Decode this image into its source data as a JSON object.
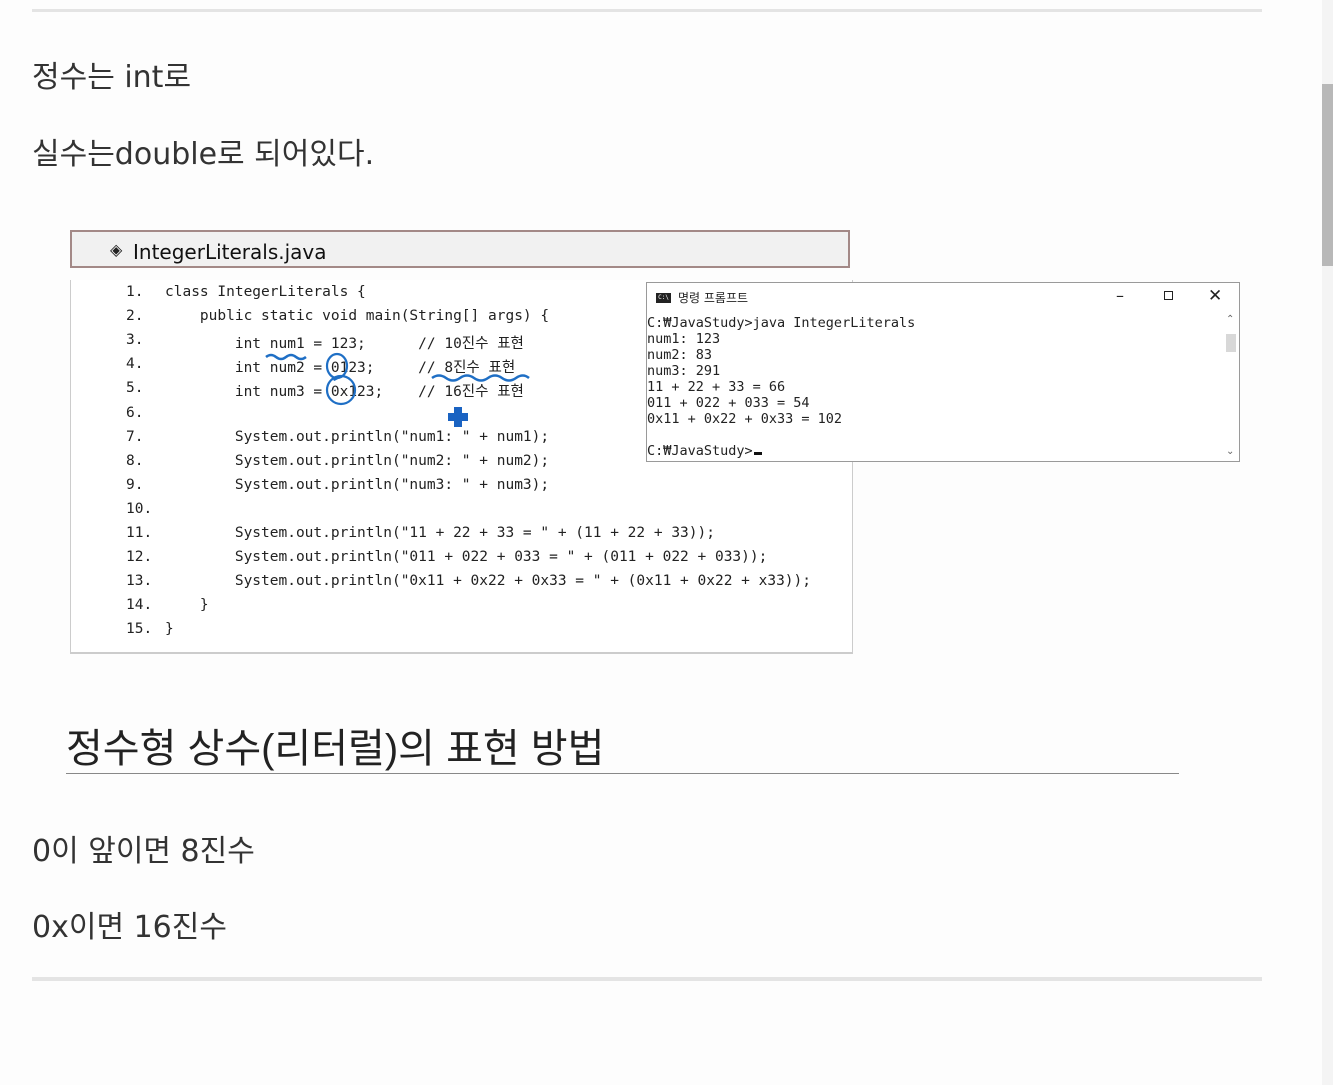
{
  "paragraphs": {
    "p1": "정수는 int로",
    "p2": "실수는double로 되어있다.",
    "p3": "0이 앞이면 8진수",
    "p4": "0x이면 16진수"
  },
  "figure": {
    "file_marker": "◈",
    "file_name": "IntegerLiterals.java",
    "code_lines": [
      {
        "num": "1.",
        "text": "class IntegerLiterals {"
      },
      {
        "num": "2.",
        "text": "    public static void main(String[] args) {"
      },
      {
        "num": "3.",
        "text": "        int num1 = 123;      // 10진수 표현"
      },
      {
        "num": "4.",
        "text": "        int num2 = 0123;     // 8진수 표현"
      },
      {
        "num": "5.",
        "text": "        int num3 = 0x123;    // 16진수 표현"
      },
      {
        "num": "6.",
        "text": ""
      },
      {
        "num": "7.",
        "text": "        System.out.println(\"num1: \" + num1);"
      },
      {
        "num": "8.",
        "text": "        System.out.println(\"num2: \" + num2);"
      },
      {
        "num": "9.",
        "text": "        System.out.println(\"num3: \" + num3);"
      },
      {
        "num": "10.",
        "text": ""
      },
      {
        "num": "11.",
        "text": "        System.out.println(\"11 + 22 + 33 = \" + (11 + 22 + 33));"
      },
      {
        "num": "12.",
        "text": "        System.out.println(\"011 + 022 + 033 = \" + (011 + 022 + 033));"
      },
      {
        "num": "13.",
        "text": "        System.out.println(\"0x11 + 0x22 + 0x33 = \" + (0x11 + 0x22 + x33));"
      },
      {
        "num": "14.",
        "text": "    }"
      },
      {
        "num": "15.",
        "text": "}"
      }
    ],
    "annotation_color": "#1f6fc5"
  },
  "console": {
    "icon_text": "C:\\",
    "title": "명령 프롬프트",
    "minimize": "–",
    "close": "✕",
    "lines": [
      "C:₩JavaStudy>java IntegerLiterals",
      "num1: 123",
      "num2: 83",
      "num3: 291",
      "11 + 22 + 33 = 66",
      "011 + 022 + 033 = 54",
      "0x11 + 0x22 + 0x33 = 102",
      "",
      "C:₩JavaStudy>"
    ],
    "scroll_up": "⌃",
    "scroll_down": "⌄"
  },
  "section": {
    "heading": "정수형 상수(리터럴)의 표현 방법"
  }
}
